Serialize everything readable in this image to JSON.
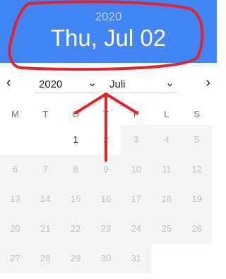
{
  "header": {
    "year": "2020",
    "date": "Thu, Jul 02"
  },
  "nav": {
    "prev_icon": "chevron-left-icon",
    "next_icon": "chevron-right-icon",
    "prev_glyph": "‹",
    "next_glyph": "›",
    "year_value": "2020",
    "month_value": "Juli",
    "dropdown_glyph": "⌄"
  },
  "weekdays": [
    "M",
    "T",
    "O",
    "T",
    "F",
    "L",
    "S"
  ],
  "days_row1": [
    {
      "label": "1",
      "state": "enabled"
    },
    {
      "label": "2",
      "state": "selected"
    },
    {
      "label": "3",
      "state": "disabled"
    },
    {
      "label": "4",
      "state": "disabled"
    },
    {
      "label": "5",
      "state": "disabled"
    }
  ],
  "days_rest": [
    [
      "6",
      "7",
      "8",
      "9",
      "10",
      "11",
      "12"
    ],
    [
      "13",
      "14",
      "15",
      "16",
      "17",
      "18",
      "19"
    ],
    [
      "20",
      "21",
      "22",
      "23",
      "24",
      "25",
      "26"
    ],
    [
      "27",
      "28",
      "29",
      "30",
      "31"
    ]
  ],
  "colors": {
    "header": "#4285f4",
    "annotation": "#e0262c",
    "selected": "#4285f4"
  }
}
